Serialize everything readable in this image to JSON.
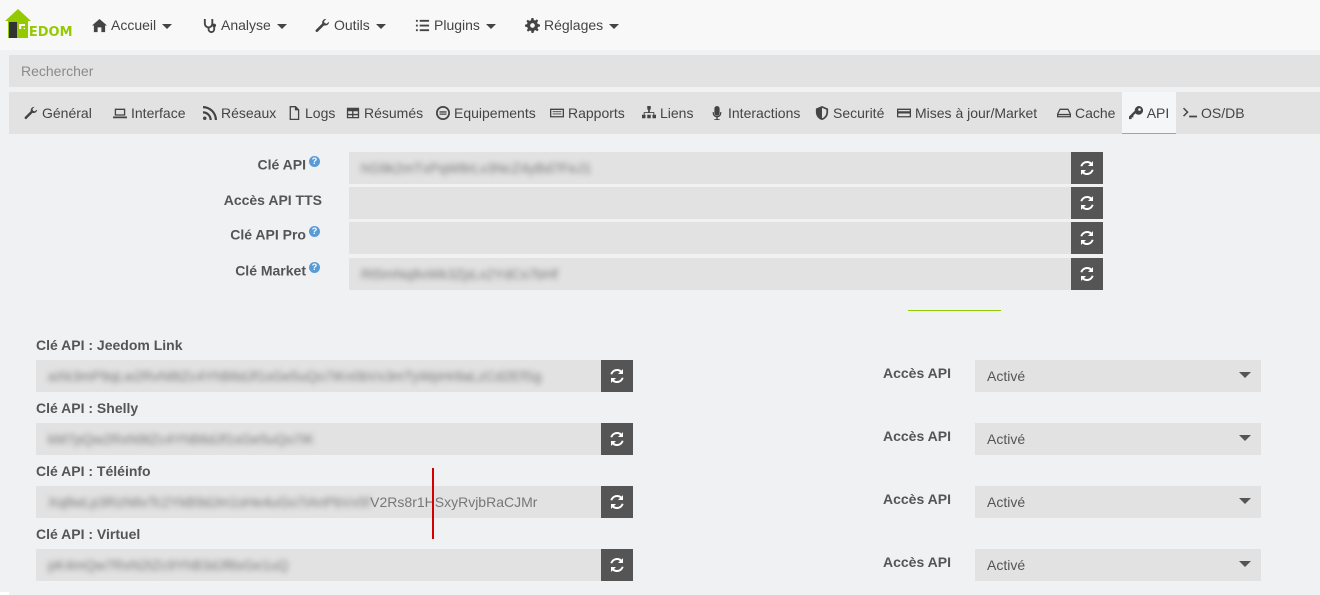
{
  "logo": {
    "text": "EEDOM",
    "alt": "Jeedom"
  },
  "nav": [
    {
      "label": "Accueil",
      "icon": "home-icon"
    },
    {
      "label": "Analyse",
      "icon": "stethoscope-icon"
    },
    {
      "label": "Outils",
      "icon": "wrench-icon"
    },
    {
      "label": "Plugins",
      "icon": "tasks-icon"
    },
    {
      "label": "Réglages",
      "icon": "cog-icon"
    }
  ],
  "search": {
    "placeholder": "Rechercher"
  },
  "tabs": [
    {
      "label": "Général",
      "icon": "wrench-icon"
    },
    {
      "label": "Interface",
      "icon": "laptop-icon"
    },
    {
      "label": "Réseaux",
      "icon": "rss-icon"
    },
    {
      "label": "Logs",
      "icon": "file-icon"
    },
    {
      "label": "Résumés",
      "icon": "table-icon"
    },
    {
      "label": "Equipements",
      "icon": "equipment-icon"
    },
    {
      "label": "Rapports",
      "icon": "report-icon"
    },
    {
      "label": "Liens",
      "icon": "sitemap-icon"
    },
    {
      "label": "Interactions",
      "icon": "microphone-icon"
    },
    {
      "label": "Securité",
      "icon": "shield-icon"
    },
    {
      "label": "Mises à jour/Market",
      "icon": "credit-card-icon"
    },
    {
      "label": "Cache",
      "icon": "hdd-icon"
    },
    {
      "label": "API",
      "icon": "key-icon"
    },
    {
      "label": "OS/DB",
      "icon": "terminal-icon"
    }
  ],
  "api": {
    "cle_api": {
      "label": "Clé API",
      "value": "hG9k2mTxPqW8rLv3NcZ4yBd7FeJ1"
    },
    "acces_api_tts": {
      "label": "Accès API TTS",
      "value": ""
    },
    "cle_api_pro": {
      "label": "Clé API Pro",
      "value": ""
    },
    "cle_market": {
      "label": "Clé Market",
      "value": "Rt5mNq8vWk3ZpLx2YdCs7bHf"
    }
  },
  "plugins": [
    {
      "label": "Clé API : Jeedom Link",
      "value": "aXk3mP9qLw2RvN8tZc4YhB6dJf1sGe5uQo7iKn0bVx3mTyWpHr8aLzCd2EfSg",
      "value_tail": "",
      "access_label": "Accès API",
      "access_value": "Activé"
    },
    {
      "label": "Clé API : Shelly",
      "value": "kM7pQw2RxN9tZc4YhB6dJf1sGe5uQo7iK",
      "value_tail": "",
      "access_label": "Accès API",
      "access_value": "Activé"
    },
    {
      "label": "Clé API : Téléinfo",
      "value": "Xq8wLp3RzN6vTc2YkB9dJm1sHe4uGo7iAnPbVx5f",
      "value_tail": "V2Rs8r1HSxyRvjbRaCJMr",
      "access_label": "Accès API",
      "access_value": "Activé"
    },
    {
      "label": "Clé API : Virtuel",
      "value": "pK4mQw7RxN2tZc9YhB3dJf8sGe1uQ",
      "value_tail": "",
      "access_label": "Accès API",
      "access_value": "Activé"
    }
  ],
  "colors": {
    "accent": "#94ca02",
    "button": "#555555",
    "field": "#e2e2e2",
    "annotation": "#d40000"
  }
}
